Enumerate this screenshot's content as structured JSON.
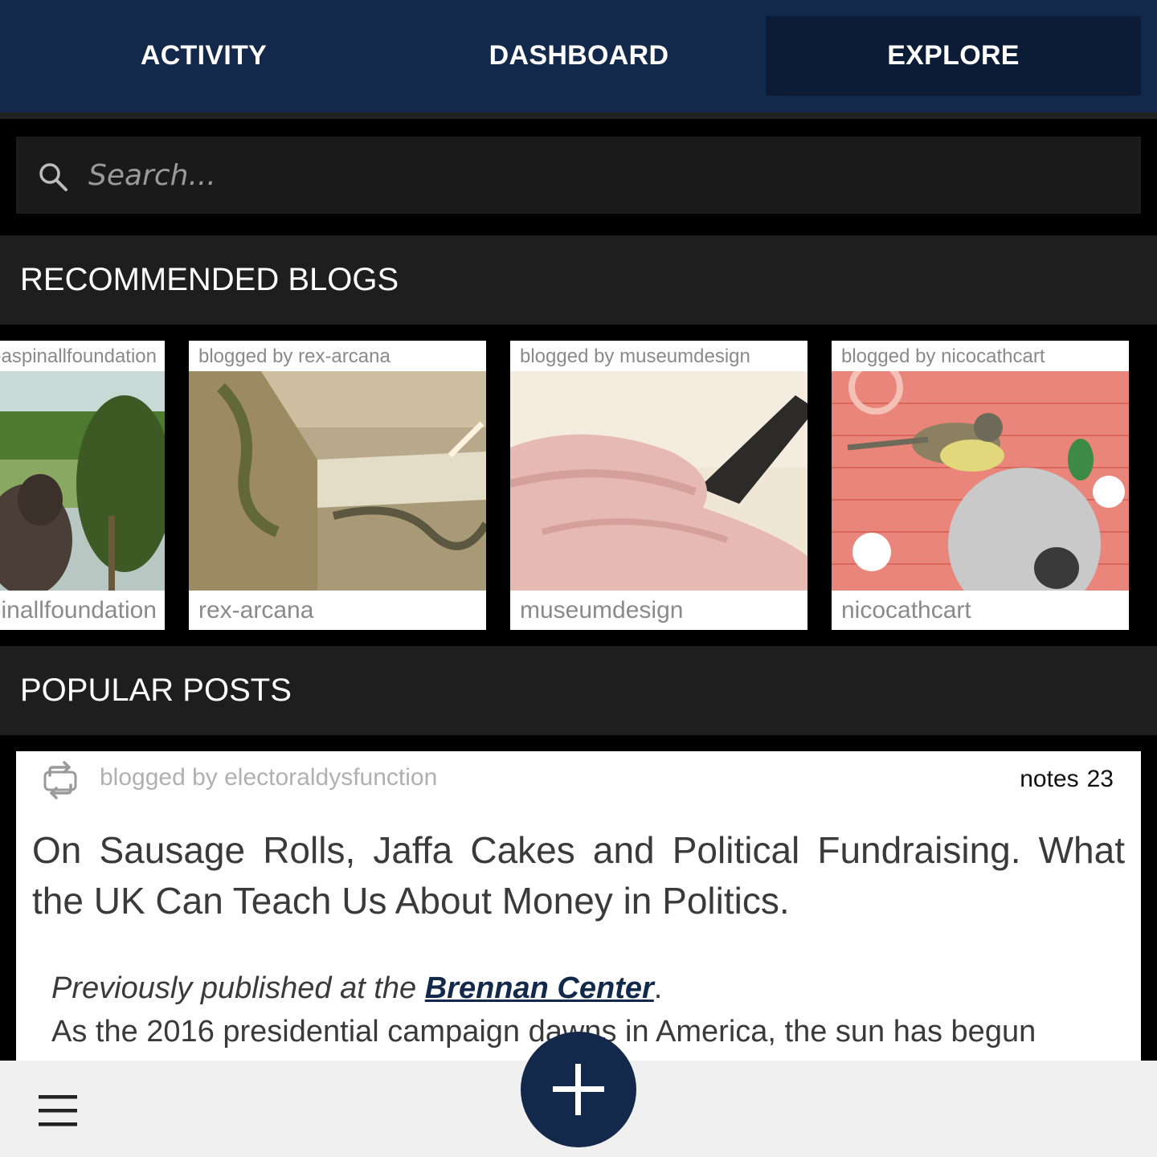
{
  "tabs": [
    {
      "label": "ACTIVITY",
      "active": false
    },
    {
      "label": "DASHBOARD",
      "active": false
    },
    {
      "label": "EXPLORE",
      "active": true
    }
  ],
  "search": {
    "placeholder": "Search..."
  },
  "recommended_blogs": {
    "heading": "RECOMMENDED BLOGS",
    "cards": [
      {
        "byline": "blogged by theaspinallfoundation",
        "name": "theaspinallfoundation"
      },
      {
        "byline": "blogged by rex-arcana",
        "name": "rex-arcana"
      },
      {
        "byline": "blogged by museumdesign",
        "name": "museumdesign"
      },
      {
        "byline": "blogged by nicocathcart",
        "name": "nicocathcart"
      }
    ]
  },
  "popular_posts": {
    "heading": "POPULAR POSTS",
    "post": {
      "byline": "blogged by electoraldysfunction",
      "notes_label": "notes",
      "notes_count": "23",
      "title": "On Sausage Rolls, Jaffa Cakes and Political Fundraising. What the UK Can Teach Us About Money in Politics.",
      "intro_prefix": "Previously published at the ",
      "intro_link": "Brennan Center",
      "intro_suffix": ".",
      "body_start": "As the 2016 presidential campaign dawns in America, the sun has begun"
    }
  },
  "colors": {
    "brand": "#13294b",
    "active_tab": "#0c1c36"
  }
}
